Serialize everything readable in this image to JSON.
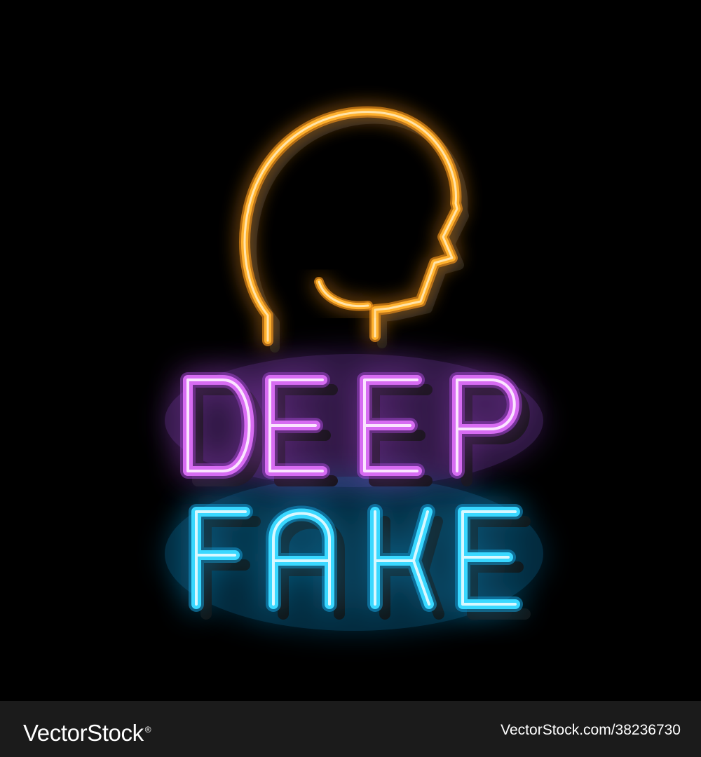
{
  "artwork": {
    "head_icon": "head-profile-icon",
    "line1": "DEEP",
    "line2": "FAKE",
    "colors": {
      "background": "#000000",
      "head": "#ffb12e",
      "line1": "#d76cf2",
      "line2": "#3ad8ff"
    }
  },
  "footer": {
    "brand": "VectorStock",
    "brand_mark": "®",
    "image_id": "VectorStock.com/38236730"
  }
}
